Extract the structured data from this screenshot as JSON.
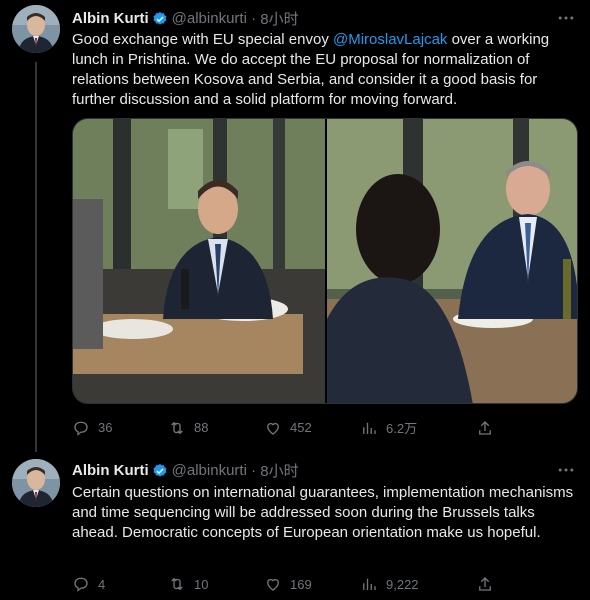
{
  "tweets": [
    {
      "author": "Albin Kurti",
      "handle": "@albinkurti",
      "time": "8小时",
      "text_before": "Good exchange with EU special envoy ",
      "mention": "@MiroslavLajcak",
      "text_after": " over a working lunch in Prishtina. We do accept the EU proposal for normalization of relations between Kosova and Serbia, and consider it a good basis for further discussion and a solid platform for moving forward.",
      "replies": "36",
      "retweets": "88",
      "likes": "452",
      "views": "6.2万"
    },
    {
      "author": "Albin Kurti",
      "handle": "@albinkurti",
      "time": "8小时",
      "text": "Certain questions on international guarantees, implementation mechanisms and time sequencing will be addressed soon during the Brussels talks ahead. Democratic concepts of European orientation make us hopeful.",
      "replies": "4",
      "retweets": "10",
      "likes": "169",
      "views": "9,222"
    }
  ],
  "colors": {
    "background": "#000000",
    "text": "#e7e9ea",
    "muted": "#71767b",
    "accent": "#1d9bf0"
  },
  "icons": [
    "verified-badge-icon",
    "more-icon",
    "reply-icon",
    "retweet-icon",
    "like-icon",
    "views-icon",
    "share-icon"
  ]
}
